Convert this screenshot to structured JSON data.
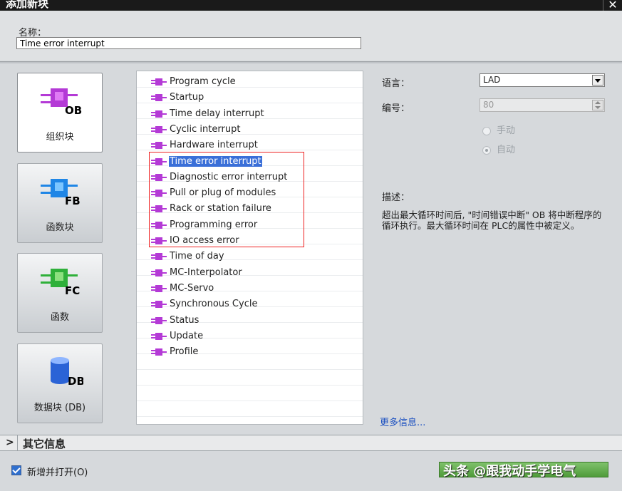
{
  "dialog": {
    "title": "添加新块",
    "close_glyph": "✕"
  },
  "name": {
    "label": "名称：",
    "value": "Time error interrupt"
  },
  "blocks": [
    {
      "id": "ob",
      "badge": "OB",
      "label": "组织块",
      "color": "#b43ad6",
      "accent": "#e07af5",
      "selected": true
    },
    {
      "id": "fb",
      "badge": "FB",
      "label": "函数块",
      "color": "#1f86e6",
      "accent": "#7cc6ff",
      "selected": false
    },
    {
      "id": "fc",
      "badge": "FC",
      "label": "函数",
      "color": "#2fb03a",
      "accent": "#8de07f",
      "selected": false
    },
    {
      "id": "db",
      "badge": "DB",
      "label": "数据块 (DB)",
      "color": "#2b63d6",
      "accent": "#8fb6ff",
      "selected": false
    }
  ],
  "ob_list": {
    "items": [
      "Program cycle",
      "Startup",
      "Time delay interrupt",
      "Cyclic interrupt",
      "Hardware interrupt",
      "Time error interrupt",
      "Diagnostic error interrupt",
      "Pull or plug of modules",
      "Rack or station failure",
      "Programming error",
      "IO access error",
      "Time of day",
      "MC-Interpolator",
      "MC-Servo",
      "Synchronous Cycle",
      "Status",
      "Update",
      "Profile"
    ],
    "selected": "Time error interrupt",
    "icon_color": "#b43ad6"
  },
  "props": {
    "language_label": "语言：",
    "language_value": "LAD",
    "number_label": "编号：",
    "number_value": "80",
    "manual_label": "手动",
    "auto_label": "自动",
    "auto_selected": true
  },
  "description": {
    "label": "描述：",
    "text": "超出最大循环时间后, \"时间错误中断\" OB 将中断程序的循环执行。最大循环时间在 PLC的属性中被定义。"
  },
  "more_info": "更多信息...",
  "other_info": {
    "chevron": ">",
    "label": "其它信息"
  },
  "footer": {
    "checkbox_label": "新增并打开(O)",
    "checkbox_checked": true,
    "watermark": "头条 @跟我动手学电气"
  }
}
